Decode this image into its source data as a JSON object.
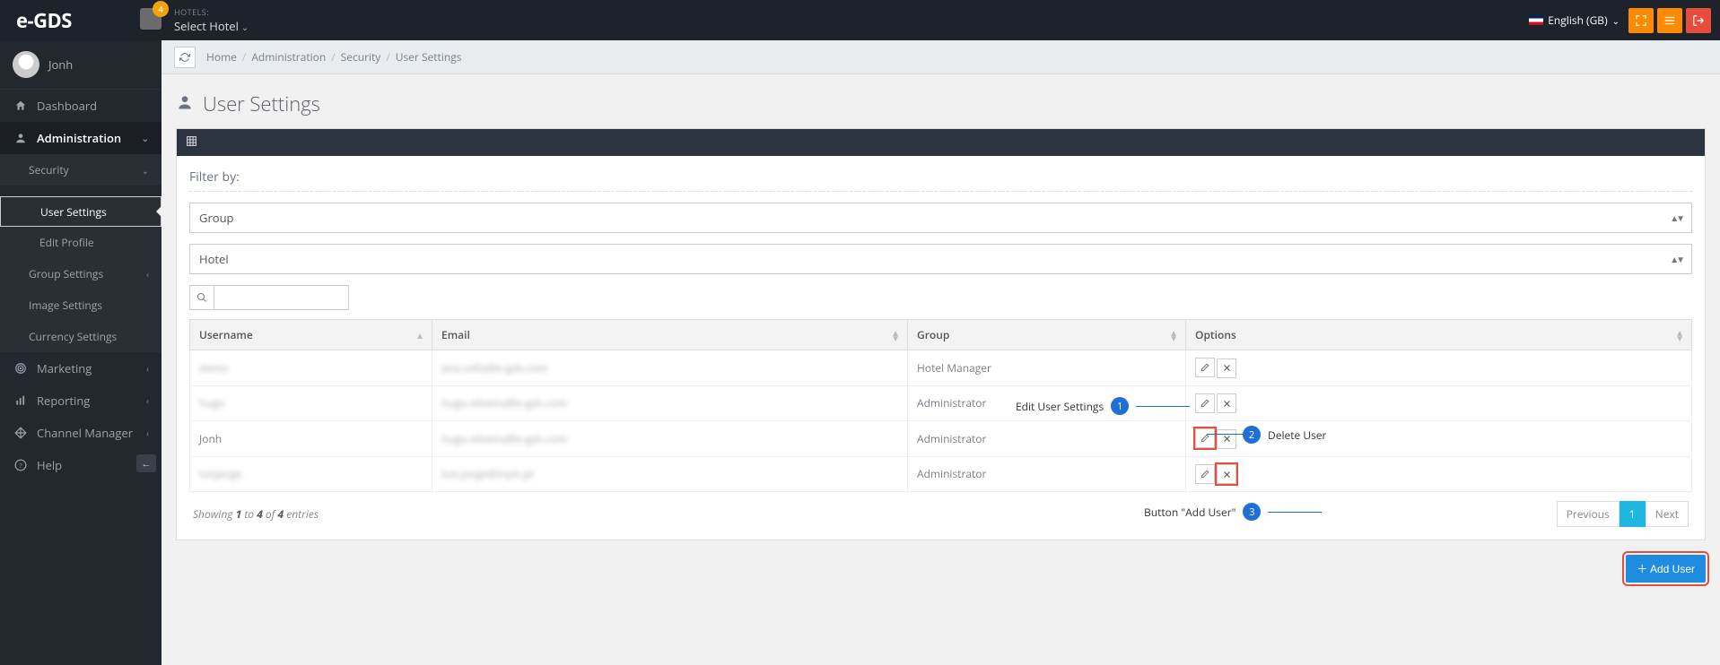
{
  "brand": "e-GDS",
  "notifications_count": "4",
  "hotel_selector": {
    "label": "HOTELS:",
    "value": "Select Hotel"
  },
  "language": "English (GB)",
  "user": {
    "name": "Jonh"
  },
  "sidebar": {
    "items": [
      {
        "label": "Dashboard",
        "icon": "home"
      },
      {
        "label": "Administration",
        "icon": "user",
        "expanded": true
      },
      {
        "label": "Marketing",
        "icon": "target"
      },
      {
        "label": "Reporting",
        "icon": "chart"
      },
      {
        "label": "Channel Manager",
        "icon": "move"
      },
      {
        "label": "Help",
        "icon": "question"
      }
    ],
    "admin_children": [
      {
        "label": "Security",
        "expanded": true
      },
      {
        "label": "Group Settings"
      },
      {
        "label": "Image Settings"
      },
      {
        "label": "Currency Settings"
      }
    ],
    "security_children": [
      {
        "label": "User Settings",
        "selected": true
      },
      {
        "label": "Edit Profile"
      }
    ]
  },
  "breadcrumb": [
    "Home",
    "Administration",
    "Security",
    "User Settings"
  ],
  "page": {
    "title": "User Settings"
  },
  "filter": {
    "label": "Filter by:",
    "group_select": "Group",
    "hotel_select": "Hotel"
  },
  "table": {
    "columns": [
      "Username",
      "Email",
      "Group",
      "Options"
    ],
    "rows": [
      {
        "username": "demo",
        "email": "ana.sofia@e-gds.com",
        "group": "Hotel Manager"
      },
      {
        "username": "hugo",
        "email": "hugo.oliveira@e-gds.com",
        "group": "Administrator"
      },
      {
        "username": "Jonh",
        "email": "hugo.oliveira@e-gds.com",
        "group": "Administrator"
      },
      {
        "username": "luisjorge",
        "email": "luis.jorge@inyst.pt",
        "group": "Administrator"
      }
    ],
    "footer": {
      "prefix": "Showing",
      "from": "1",
      "to_word": "to",
      "to": "4",
      "of_word": "of",
      "total": "4",
      "suffix": "entries"
    },
    "pager": {
      "previous": "Previous",
      "pages": [
        "1"
      ],
      "next": "Next"
    }
  },
  "buttons": {
    "add_user": "Add User"
  },
  "callouts": {
    "edit": "Edit User Settings",
    "delete": "Delete User",
    "add": "Button \"Add User\""
  }
}
